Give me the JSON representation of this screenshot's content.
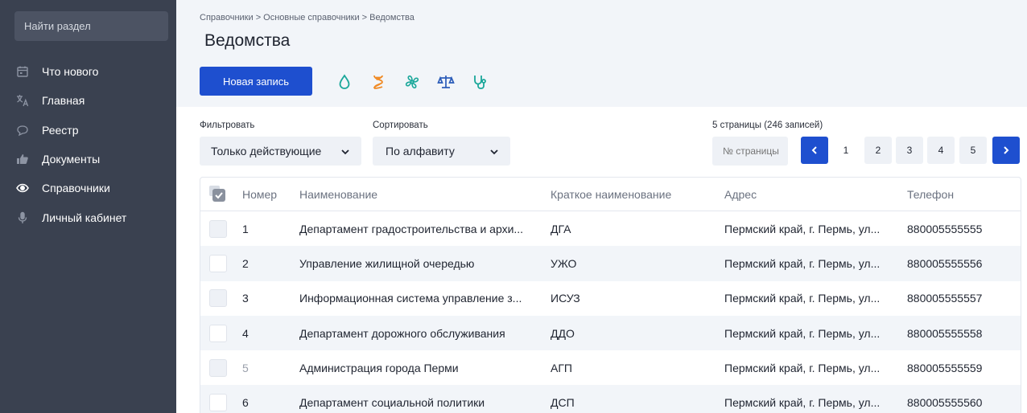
{
  "sidebar": {
    "search_placeholder": "Найти раздел",
    "items": [
      {
        "label": "Что нового",
        "icon": "calendar-icon"
      },
      {
        "label": "Главная",
        "icon": "translate-icon"
      },
      {
        "label": "Реестр",
        "icon": "chat-bubble-icon"
      },
      {
        "label": "Документы",
        "icon": "thumbs-up-icon"
      },
      {
        "label": "Справочники",
        "icon": "eye-icon",
        "active": true
      },
      {
        "label": "Личный кабинет",
        "icon": "microphone-icon"
      }
    ]
  },
  "header": {
    "breadcrumb": "Справочники > Основные справочники > Ведомства",
    "title": "Ведомства",
    "new_button": "Новая запись",
    "quick_icons": [
      "water-drop-icon",
      "dna-icon",
      "fan-icon",
      "scales-icon",
      "stethoscope-icon"
    ]
  },
  "filters": {
    "filter_label": "Фильтровать",
    "filter_value": "Только действующие",
    "sort_label": "Сортировать",
    "sort_value": "По алфавиту"
  },
  "pagination": {
    "info": "5 страницы (246 записей)",
    "page_input_placeholder": "№ страницы",
    "pages": [
      "1",
      "2",
      "3",
      "4",
      "5"
    ],
    "current_page": "1"
  },
  "table": {
    "columns": [
      "Номер",
      "Наименование",
      "Краткое наименование",
      "Адрес",
      "Телефон"
    ],
    "rows": [
      {
        "num": "1",
        "name": "Департамент градостроительства и архи...",
        "short": "ДГА",
        "addr": "Пермский край, г. Пермь, ул...",
        "tel": "880005555555"
      },
      {
        "num": "2",
        "name": "Управление жилищной очередью",
        "short": "УЖО",
        "addr": "Пермский край, г. Пермь, ул...",
        "tel": "880005555556"
      },
      {
        "num": "3",
        "name": "Информационная система управление з...",
        "short": "ИСУЗ",
        "addr": "Пермский край, г. Пермь, ул...",
        "tel": "880005555557"
      },
      {
        "num": "4",
        "name": "Департамент дорожного обслуживания",
        "short": "ДДО",
        "addr": "Пермский край, г. Пермь, ул...",
        "tel": "880005555558"
      },
      {
        "num": "5",
        "name": "Администрация города Перми",
        "short": "АГП",
        "addr": "Пермский край, г. Пермь, ул...",
        "tel": "880005555559"
      },
      {
        "num": "6",
        "name": "Департамент социальной политики",
        "short": "ДСП",
        "addr": "Пермский край, г. Пермь, ул...",
        "tel": "880005555560"
      }
    ]
  },
  "colors": {
    "sidebar_bg": "#3a4150",
    "primary": "#1e4fcf",
    "icon_teal": "#1aa79a",
    "icon_orange": "#f08a24",
    "icon_blue": "#2a5bb8"
  }
}
